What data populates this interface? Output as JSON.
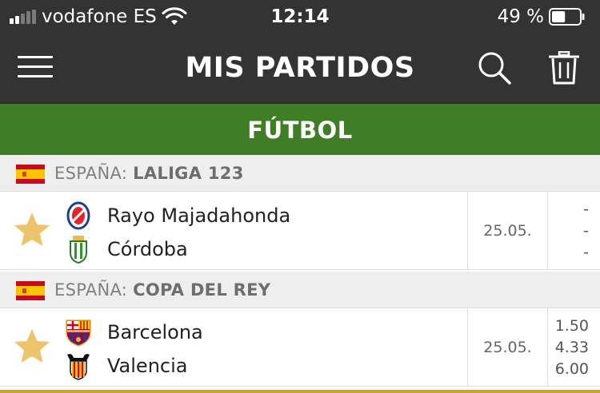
{
  "status_bar": {
    "carrier": "vodafone ES",
    "time": "12:14",
    "battery_percent": "49 %",
    "battery_level": 0.49,
    "signal_bars_filled": 2,
    "signal_bars_total": 5
  },
  "header": {
    "title": "MIS PARTIDOS",
    "icons": [
      "menu-icon",
      "search-icon",
      "trash-icon"
    ]
  },
  "sport": {
    "label": "FÚTBOL"
  },
  "leagues": [
    {
      "country": "ESPAÑA:",
      "name": "LALIGA 123",
      "flag": "spain-flag",
      "matches": [
        {
          "home": "Rayo Majadahonda",
          "away": "Córdoba",
          "date": "25.05.",
          "odds": [
            "-",
            "-",
            "-"
          ]
        }
      ]
    },
    {
      "country": "ESPAÑA:",
      "name": "COPA DEL REY",
      "flag": "spain-flag",
      "matches": [
        {
          "home": "Barcelona",
          "away": "Valencia",
          "date": "25.05.",
          "odds": [
            "1.50",
            "4.33",
            "6.00"
          ]
        }
      ]
    }
  ],
  "colors": {
    "nav_background": "#333333",
    "sport_bar": "#3f7e26",
    "star": "#eec46b",
    "league_header_bg": "#eeeeee"
  }
}
